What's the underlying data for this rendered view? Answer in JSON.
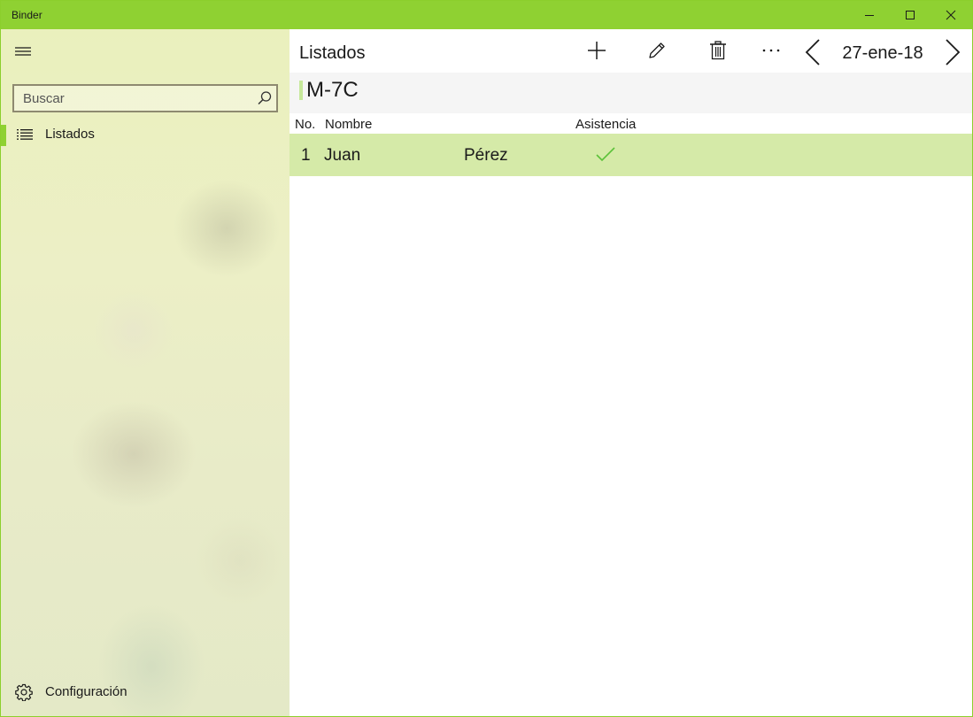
{
  "window": {
    "title": "Binder"
  },
  "sidebar": {
    "search": {
      "placeholder": "Buscar",
      "value": ""
    },
    "items": [
      {
        "label": "Listados",
        "icon": "list-icon",
        "selected": true
      }
    ],
    "settings": {
      "label": "Configuración",
      "icon": "gear-icon"
    }
  },
  "main": {
    "title": "Listados",
    "commands": [
      "add-icon",
      "edit-icon",
      "delete-icon",
      "more-icon"
    ],
    "date": "27-ene-18",
    "list_name": "M-7C",
    "columns": {
      "no": "No.",
      "name": "Nombre",
      "attendance": "Asistencia"
    },
    "rows": [
      {
        "no": "1",
        "first_name": "Juan",
        "last_name": "Pérez",
        "present": true
      }
    ]
  },
  "colors": {
    "accent": "#8fd132",
    "row_selected": "#d5eaa8",
    "check": "#5cc23a",
    "list_accent": "#c6e89a"
  }
}
